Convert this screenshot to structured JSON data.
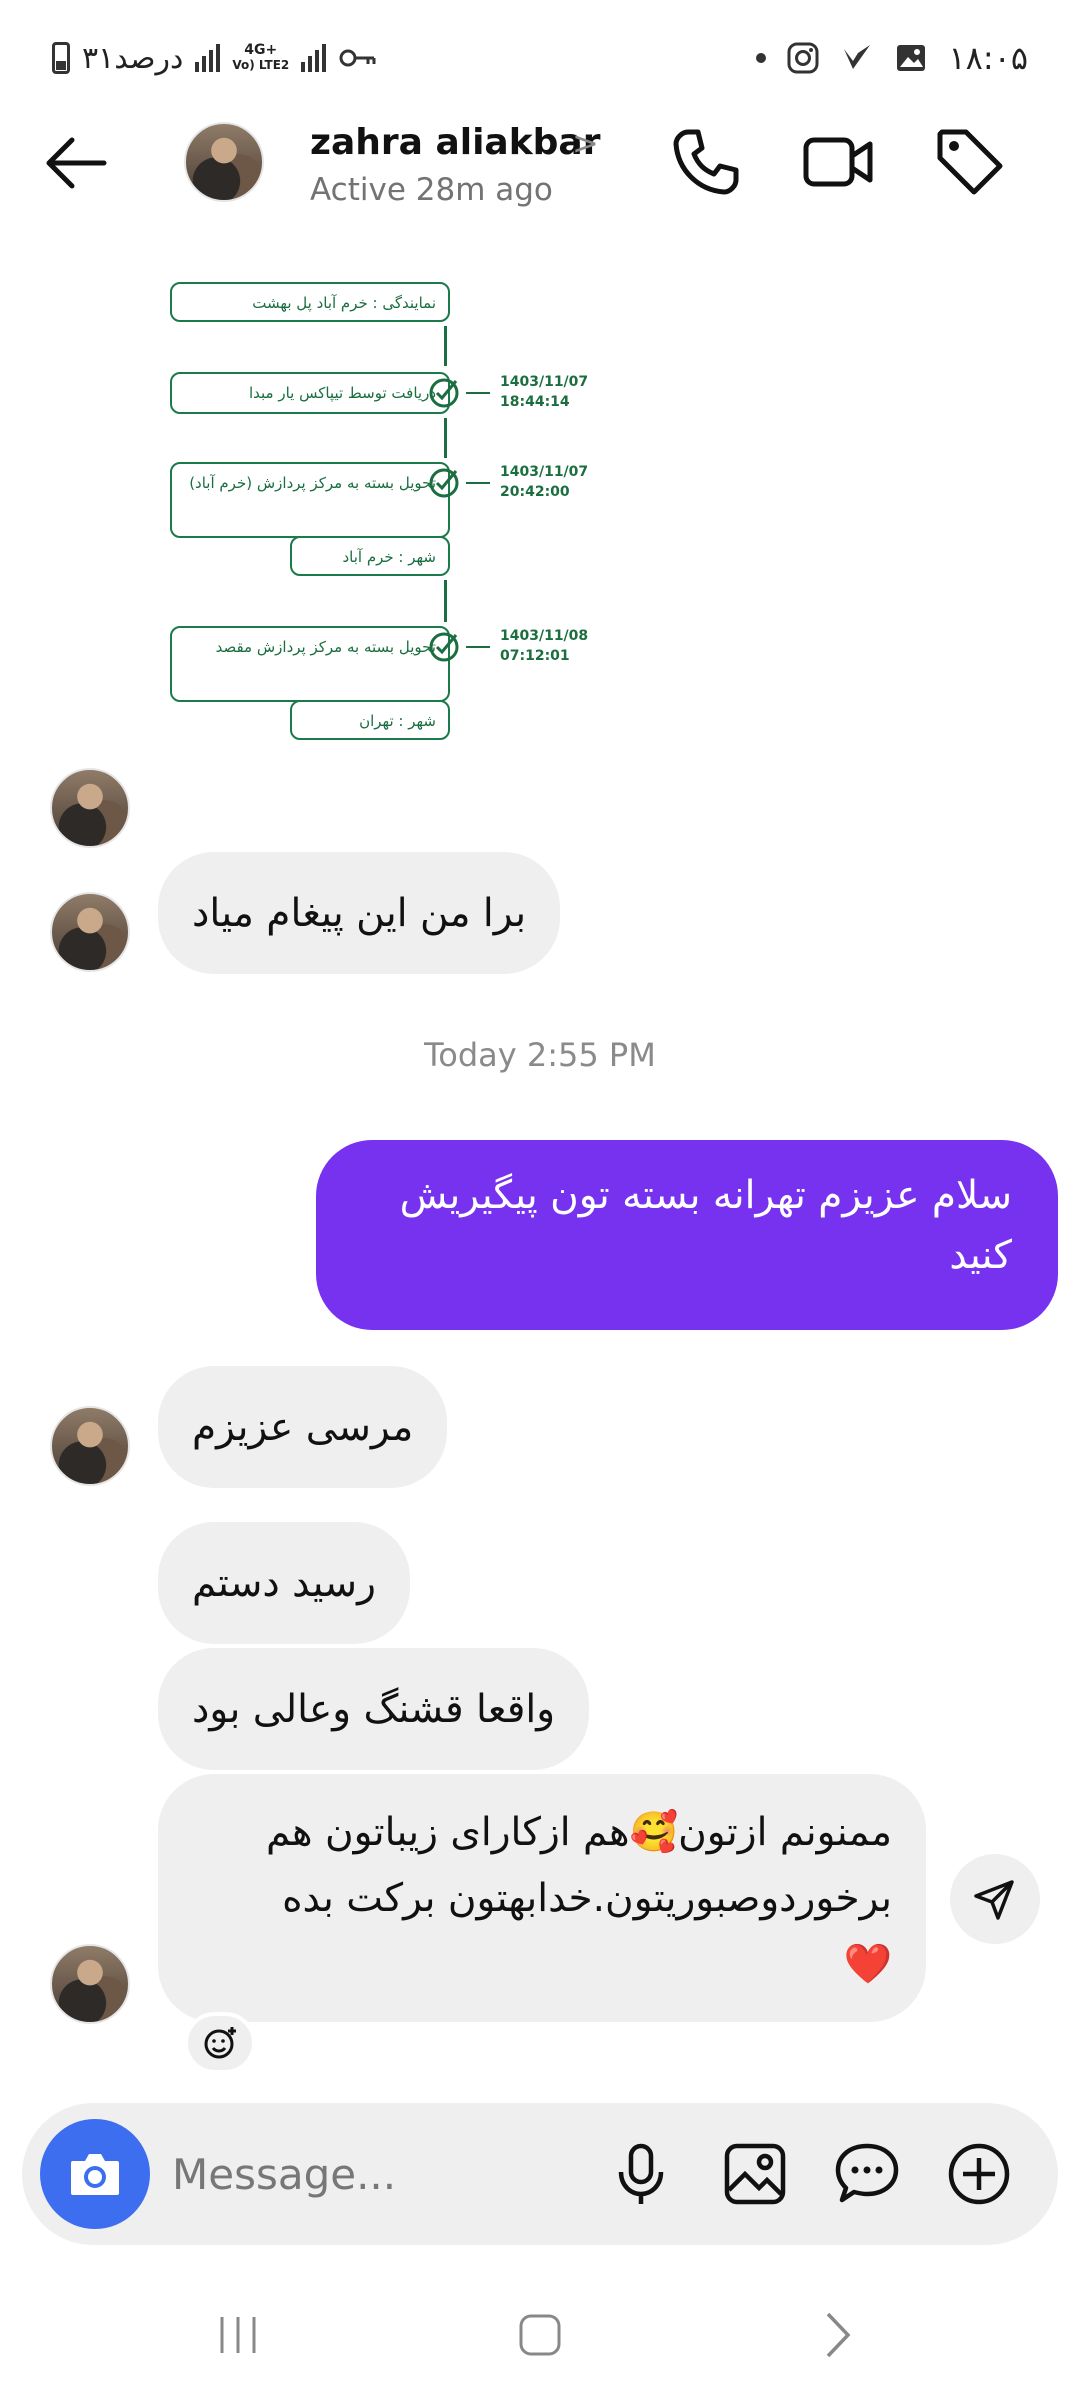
{
  "status_bar": {
    "time": "۱۸:۰۵",
    "battery_text": "۳۱درصد",
    "net_top": "4G+",
    "net_bottom": "Vo) LTE2",
    "icons": [
      "dot-icon",
      "instagram-icon",
      "v-app-icon",
      "gallery-icon",
      "key-icon"
    ]
  },
  "header": {
    "name": "zahra aliakbar",
    "status": "Active 28m ago",
    "icons": [
      "back-arrow-icon",
      "phone-icon",
      "video-call-icon",
      "tag-icon"
    ]
  },
  "tracking": {
    "agency": "نمایندگی : خرم آباد پل بهشت",
    "step1_text": "دریافت توسط تیپاکس یار مبدا",
    "step1_date": "1403/11/07",
    "step1_time": "18:44:14",
    "step2_text": "تحویل بسته به مرکز پردازش (خرم آباد)",
    "step2_date": "1403/11/07",
    "step2_time": "20:42:00",
    "step2_city": "شهر : خرم آباد",
    "step3_text": "تحویل بسته به مرکز پردازش مقصد",
    "step3_date": "1403/11/08",
    "step3_time": "07:12:01",
    "step3_city": "شهر : تهران"
  },
  "messages": {
    "m1": "برا من این پیغام میاد",
    "timestamp": "Today 2:55 PM",
    "m2": "سلام عزیزم تهرانه بسته تون پیگیریش کنید",
    "m3": "مرسی عزیزم",
    "m4": "رسید دستم",
    "m5": "واقعا قشنگ وعالی بود",
    "m6_line1": "ممنونم ازتون🥰هم ازکارای زیباتون هم",
    "m6_line2": "برخوردوصبوریتون.خدابهتون برکت بده",
    "m6_line3": "❤️"
  },
  "composer": {
    "placeholder": "Message..."
  },
  "colors": {
    "outgoing_bubble": "#7732f0",
    "incoming_bubble": "#efefef",
    "camera_button": "#3d6ef0",
    "tracking_green": "#1a6e3f"
  }
}
